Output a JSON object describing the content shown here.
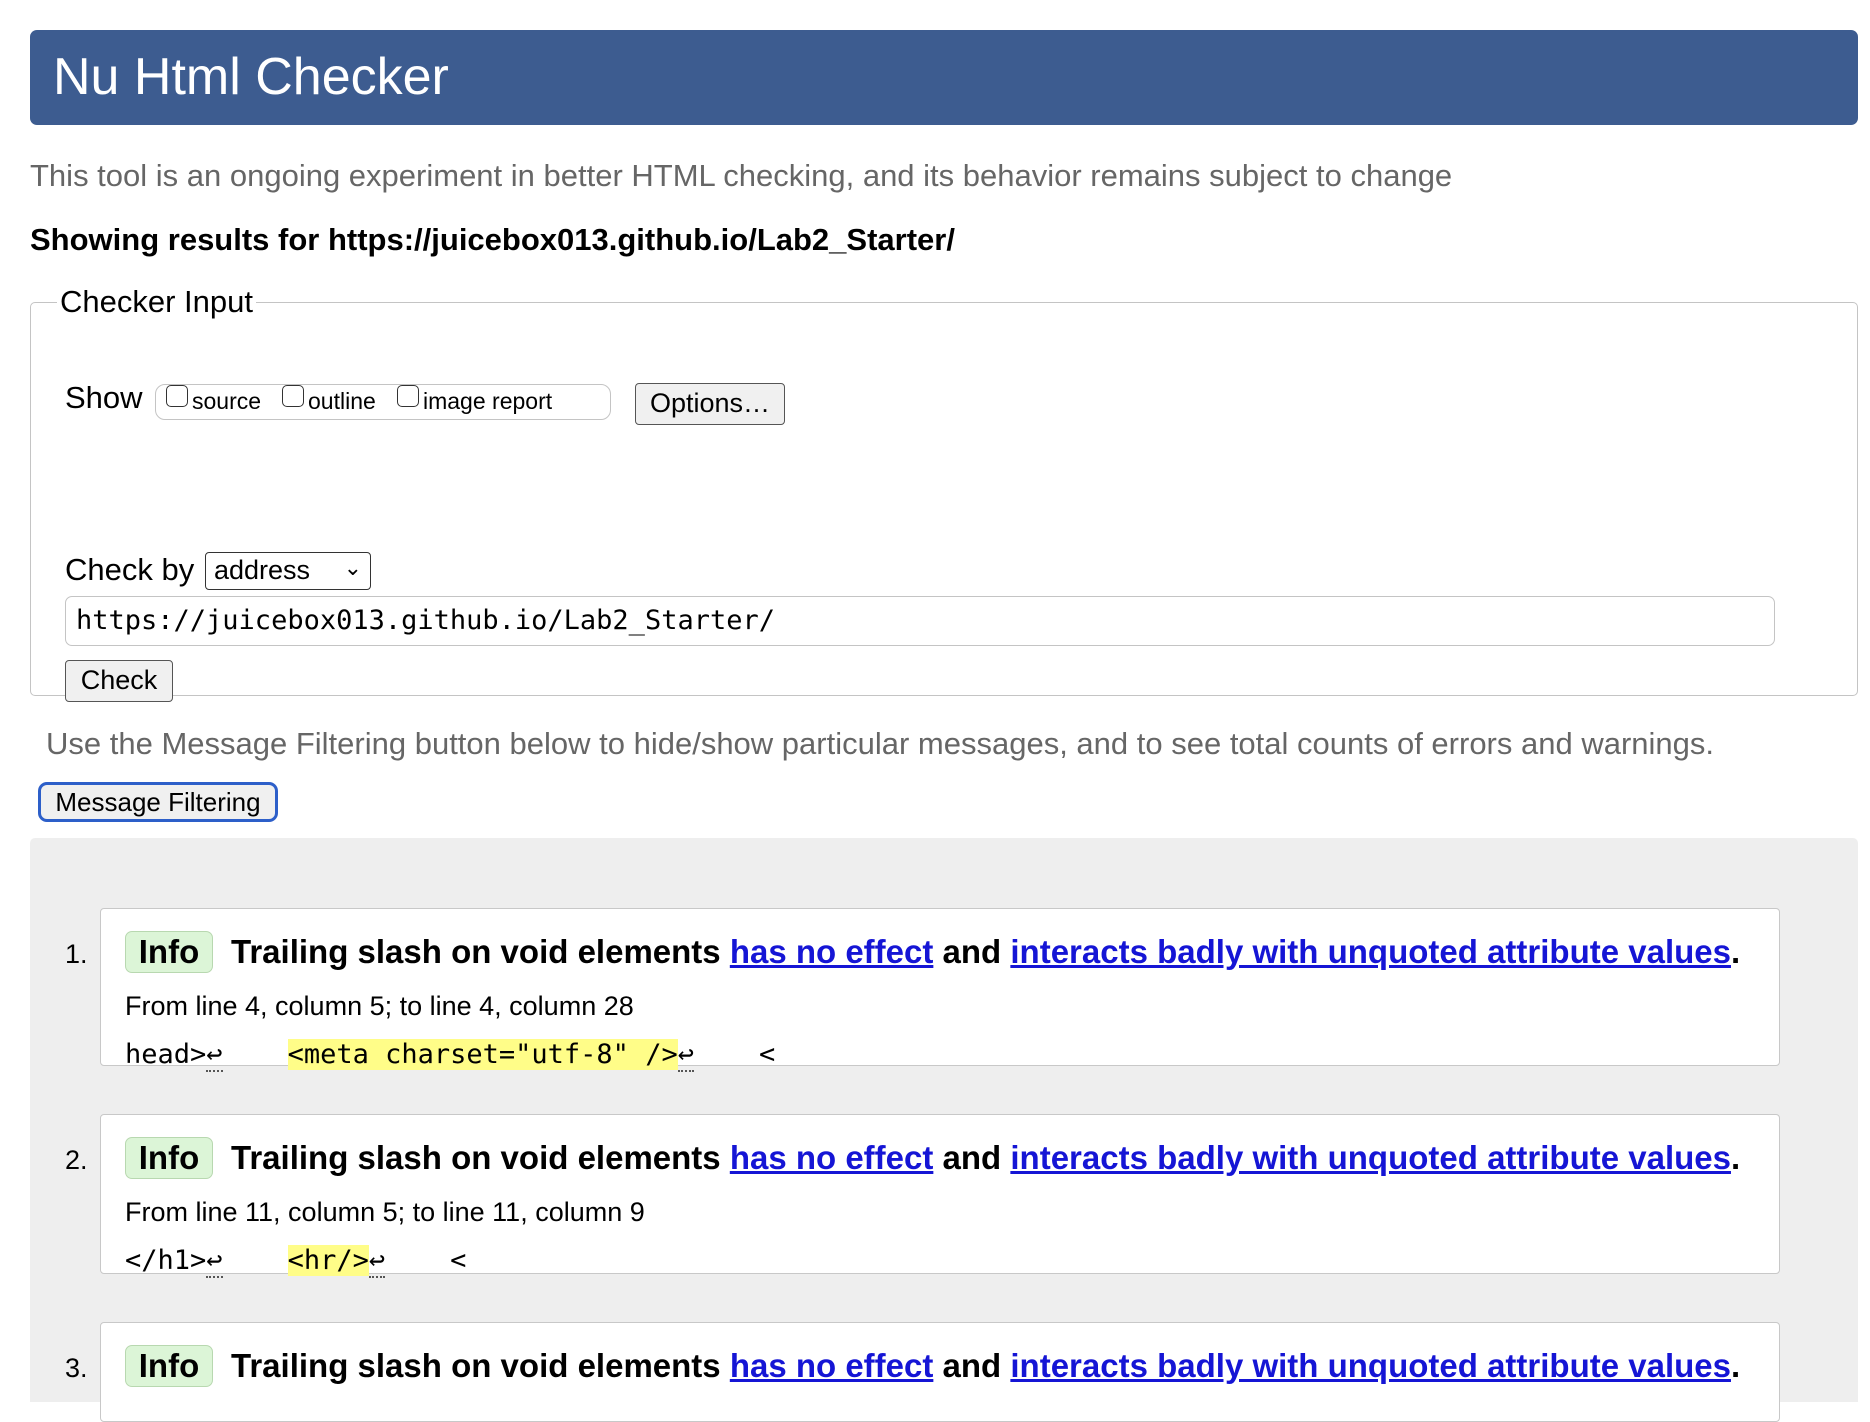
{
  "header": {
    "title": "Nu Html Checker"
  },
  "intro": "This tool is an ongoing experiment in better HTML checking, and its behavior remains subject to change",
  "showing": "Showing results for https://juicebox013.github.io/Lab2_Starter/",
  "checker_input": {
    "legend": "Checker Input",
    "show_label": "Show",
    "checkboxes": [
      {
        "label": "source",
        "checked": false
      },
      {
        "label": "outline",
        "checked": false
      },
      {
        "label": "image report",
        "checked": false
      }
    ],
    "options_label": "Options…",
    "check_by_label": "Check by",
    "check_by_value": "address",
    "url_value": "https://juicebox013.github.io/Lab2_Starter/",
    "check_label": "Check"
  },
  "filter_note": "Use the Message Filtering button below to hide/show particular messages, and to see total counts of errors and warnings.",
  "filter_button": "Message Filtering",
  "messages": [
    {
      "num": "1.",
      "type": "Info",
      "text_a": "Trailing slash on void elements",
      "link1": "has no effect",
      "text_b": "and",
      "link2": "interacts badly with unquoted attribute values",
      "text_c": ".",
      "location": "From line 4, column 5; to line 4, column 28",
      "extract_pre": "head>",
      "extract_lf1": "↩",
      "extract_gap": "    ",
      "extract_hl": "<meta charset=\"utf-8\" />",
      "extract_lf2": "↩",
      "extract_post": "    <"
    },
    {
      "num": "2.",
      "type": "Info",
      "text_a": "Trailing slash on void elements",
      "link1": "has no effect",
      "text_b": "and",
      "link2": "interacts badly with unquoted attribute values",
      "text_c": ".",
      "location": "From line 11, column 5; to line 11, column 9",
      "extract_pre": "</h1>",
      "extract_lf1": "↩",
      "extract_gap": "    ",
      "extract_hl": "<hr/>",
      "extract_lf2": "↩",
      "extract_post": "    <"
    },
    {
      "num": "3.",
      "type": "Info",
      "text_a": "Trailing slash on void elements",
      "link1": "has no effect",
      "text_b": "and",
      "link2": "interacts badly with unquoted attribute values",
      "text_c": "."
    }
  ]
}
